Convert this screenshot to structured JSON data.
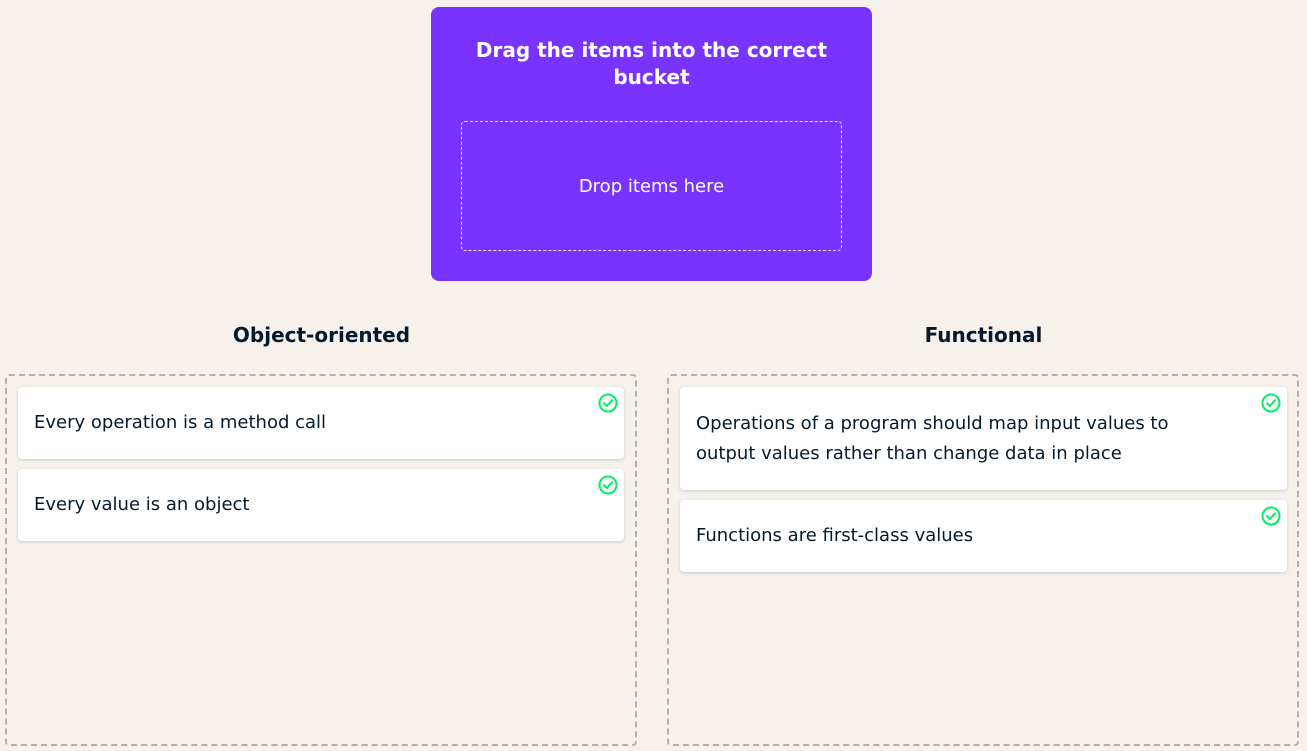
{
  "prompt": {
    "title": "Drag the items into the correct bucket",
    "dropzone_label": "Drop items here"
  },
  "buckets": [
    {
      "title": "Object-oriented",
      "items": [
        {
          "text": "Every operation is a method call",
          "status_icon": "check-circle-icon"
        },
        {
          "text": "Every value is an object",
          "status_icon": "check-circle-icon"
        }
      ]
    },
    {
      "title": "Functional",
      "items": [
        {
          "text": "Operations of a program should map input values to output values rather than change data in place",
          "status_icon": "check-circle-icon"
        },
        {
          "text": "Functions are first-class values",
          "status_icon": "check-circle-icon"
        }
      ]
    }
  ],
  "colors": {
    "background": "#f6f1eb",
    "prompt_card": "#7933ff",
    "text": "#05192d",
    "correct": "#03ef62"
  }
}
